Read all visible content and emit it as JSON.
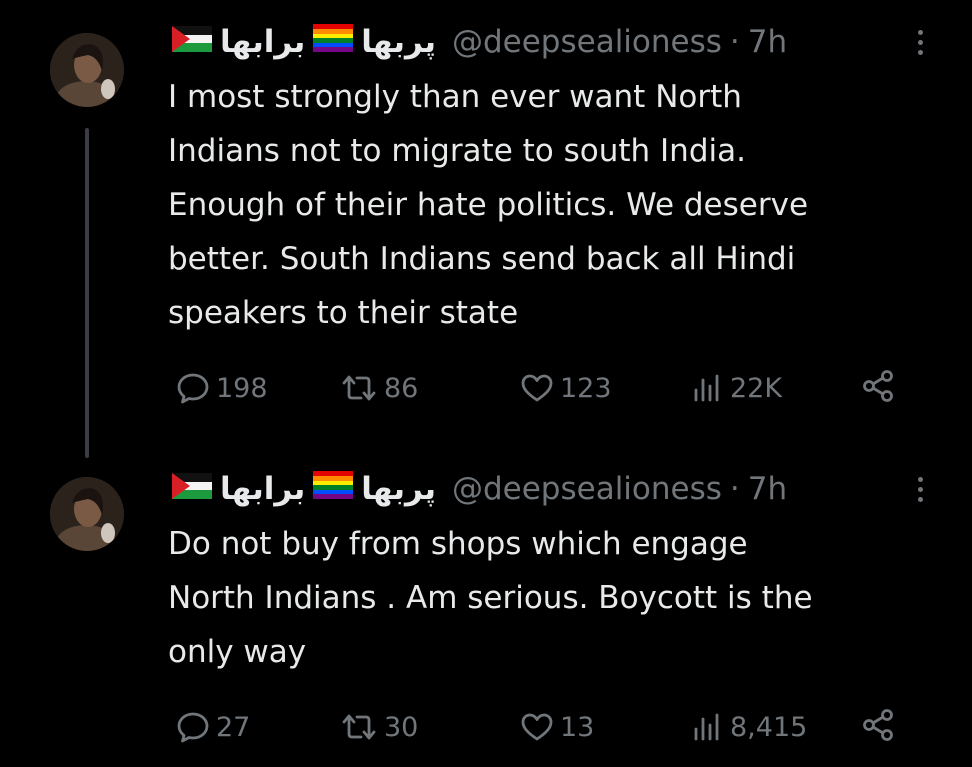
{
  "colors": {
    "background": "#000000",
    "primary_text": "#e7e9ea",
    "secondary_text": "#71767b",
    "thread_line": "#3a3d41"
  },
  "tweets": [
    {
      "author": {
        "name_part1": "پربها",
        "name_part2": "برابها",
        "flags": [
          "rainbow-flag-icon",
          "palestine-flag-icon"
        ]
      },
      "handle": "@deepsealioness",
      "separator": "·",
      "time": "7h",
      "text_lines": [
        "I most strongly than ever want North",
        "Indians not to migrate to south India.",
        "Enough of their hate politics. We deserve",
        "better. South Indians send back all Hindi",
        "speakers to their state"
      ],
      "actions": {
        "replies": "198",
        "reposts": "86",
        "likes": "123",
        "views": "22K"
      },
      "icons": [
        "reply-icon",
        "repost-icon",
        "like-icon",
        "views-icon",
        "share-icon",
        "more-icon"
      ]
    },
    {
      "author": {
        "name_part1": "پربها",
        "name_part2": "برابها",
        "flags": [
          "rainbow-flag-icon",
          "palestine-flag-icon"
        ]
      },
      "handle": "@deepsealioness",
      "separator": "·",
      "time": "7h",
      "text_lines": [
        "Do not buy from shops which engage",
        "North Indians . Am serious. Boycott is the",
        "only way"
      ],
      "actions": {
        "replies": "27",
        "reposts": "30",
        "likes": "13",
        "views": "8,415"
      },
      "icons": [
        "reply-icon",
        "repost-icon",
        "like-icon",
        "views-icon",
        "share-icon",
        "more-icon"
      ]
    }
  ]
}
